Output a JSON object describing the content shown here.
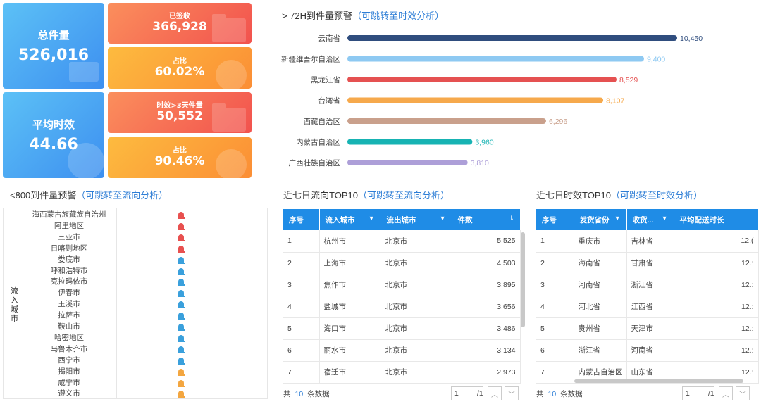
{
  "kpis": {
    "total": {
      "label": "总件量",
      "value": "526,016"
    },
    "signed": {
      "label": "已签收",
      "value": "366,928"
    },
    "signed_ratio": {
      "label": "占比",
      "value": "60.02%"
    },
    "avg_time": {
      "label": "平均时效",
      "value": "44.66"
    },
    "over3": {
      "label": "时效>3天件量",
      "value": "50,552"
    },
    "over3_ratio": {
      "label": "占比",
      "value": "90.46%"
    }
  },
  "sections": {
    "h72": {
      "title": "> 72H到件量预警",
      "link": "（可跳转至时效分析）"
    },
    "lt800": {
      "title": "<800到件量预警",
      "link": "（可跳转至流向分析）"
    },
    "flow": {
      "title": "近七日流向TOP10",
      "link": "（可跳转至流向分析）"
    },
    "timeliness": {
      "title": "近七日时效TOP10",
      "link": "（可跳转至时效分析）"
    }
  },
  "chart_data": {
    "type": "bar",
    "orientation": "horizontal",
    "categories": [
      "云南省",
      "新疆维吾尔自治区",
      "黑龙江省",
      "台湾省",
      "西藏自治区",
      "内蒙古自治区",
      "广西壮族自治区"
    ],
    "values": [
      10450,
      9400,
      8529,
      8107,
      6296,
      3960,
      3810
    ],
    "value_labels": [
      "10,450",
      "9,400",
      "8,529",
      "8,107",
      "6,296",
      "3,960",
      "3,810"
    ],
    "colors": [
      "#2f4d7e",
      "#8ec9f2",
      "#e55151",
      "#f6a94c",
      "#c9a08c",
      "#17b3b3",
      "#ad9fd8"
    ],
    "xlim": [
      0,
      10450
    ],
    "grid": false,
    "legend": "none"
  },
  "alert_table": {
    "axis_label": "流入城市",
    "cities": [
      "海西蒙古族藏族自治州",
      "阿里地区",
      "三亚市",
      "日喀则地区",
      "娄底市",
      "呼和浩特市",
      "克拉玛依市",
      "伊春市",
      "玉溪市",
      "拉萨市",
      "鞍山市",
      "哈密地区",
      "乌鲁木齐市",
      "西宁市",
      "揭阳市",
      "咸宁市",
      "遵义市"
    ],
    "alarm_levels": [
      "red",
      "red",
      "red",
      "red",
      "blue",
      "blue",
      "blue",
      "blue",
      "blue",
      "blue",
      "blue",
      "blue",
      "blue",
      "blue",
      "orange",
      "orange",
      "orange"
    ],
    "alarm_colors": {
      "red": "#e8504f",
      "blue": "#3aa0dc",
      "orange": "#f3a640"
    }
  },
  "flow_table": {
    "headers": [
      "序号",
      "流入城市",
      "流出城市",
      "件数"
    ],
    "rows": [
      [
        "1",
        "杭州市",
        "北京市",
        "5,525"
      ],
      [
        "2",
        "上海市",
        "北京市",
        "4,503"
      ],
      [
        "3",
        "焦作市",
        "北京市",
        "3,895"
      ],
      [
        "4",
        "盐城市",
        "北京市",
        "3,656"
      ],
      [
        "5",
        "海口市",
        "北京市",
        "3,486"
      ],
      [
        "6",
        "丽水市",
        "北京市",
        "3,134"
      ],
      [
        "7",
        "宿迁市",
        "北京市",
        "2,973"
      ]
    ],
    "pager": {
      "prefix": "共",
      "count": "10",
      "suffix": "条数据",
      "page": "1",
      "total": "/1"
    }
  },
  "time_table": {
    "headers": [
      "序号",
      "发货省份",
      "收货...",
      "平均配送时长"
    ],
    "rows": [
      [
        "1",
        "重庆市",
        "吉林省",
        "12.("
      ],
      [
        "2",
        "海南省",
        "甘肃省",
        "12.:"
      ],
      [
        "3",
        "河南省",
        "浙江省",
        "12.:"
      ],
      [
        "4",
        "河北省",
        "江西省",
        "12.:"
      ],
      [
        "5",
        "贵州省",
        "天津市",
        "12.:"
      ],
      [
        "6",
        "浙江省",
        "河南省",
        "12.:"
      ],
      [
        "7",
        "内蒙古自治区",
        "山东省",
        "12.:"
      ]
    ],
    "pager": {
      "prefix": "共",
      "count": "10",
      "suffix": "条数据",
      "page": "1",
      "total": "/1"
    }
  }
}
